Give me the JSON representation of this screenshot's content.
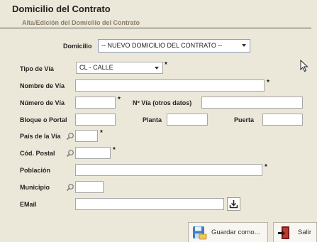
{
  "header": {
    "title": "Domicilio del Contrato",
    "subtitle": "Alta/Edición del Domicilio del Contrato"
  },
  "domicilio": {
    "label": "Domicilio",
    "selected": "-- NUEVO DOMICILIO DEL CONTRATO --"
  },
  "form": {
    "tipo_via": {
      "label": "Tipo de Vía",
      "value": "CL - CALLE",
      "required": "*"
    },
    "nombre_via": {
      "label": "Nombre de Vía",
      "value": "",
      "required": "*"
    },
    "numero_via": {
      "label": "Número de Vía",
      "value": "",
      "required": "*"
    },
    "num_otros": {
      "label": "Nº Vía (otros datos)",
      "value": ""
    },
    "bloque": {
      "label": "Bloque o Portal",
      "value": ""
    },
    "planta": {
      "label": "Planta",
      "value": ""
    },
    "puerta": {
      "label": "Puerta",
      "value": ""
    },
    "pais": {
      "label": "País de la Vía",
      "value": "",
      "required": "*"
    },
    "cod_postal": {
      "label": "Cód. Postal",
      "value": "",
      "required": "*"
    },
    "poblacion": {
      "label": "Población",
      "value": "",
      "required": "*"
    },
    "municipio": {
      "label": "Municipio",
      "value": ""
    },
    "email": {
      "label": "EMail",
      "value": ""
    }
  },
  "buttons": {
    "guardar": "Guardar como...",
    "salir": "Salir"
  },
  "icons": {
    "search": "magnifier-icon",
    "import": "download-tray-icon",
    "save": "save-as-icon",
    "exit": "exit-door-icon",
    "cursor": "mouse-pointer-icon"
  }
}
